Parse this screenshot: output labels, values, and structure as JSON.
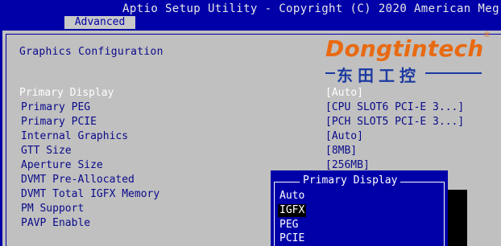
{
  "title_bar": {
    "text": "Aptio Setup Utility - Copyright (C) 2020 American Meg"
  },
  "tabs": [
    {
      "label": "Advanced",
      "active": true
    }
  ],
  "section_title": "Graphics Configuration",
  "settings": [
    {
      "label": "Primary Display",
      "value": "[Auto]",
      "selected": true
    },
    {
      "label": " Primary PEG",
      "value": "[CPU SLOT6 PCI-E 3...]",
      "selected": false
    },
    {
      "label": " Primary PCIE",
      "value": "[PCH SLOT5 PCI-E 3...]",
      "selected": false
    },
    {
      "label": "Internal Graphics",
      "value": "[Auto]",
      "selected": false
    },
    {
      "label": "GTT Size",
      "value": "[8MB]",
      "selected": false
    },
    {
      "label": "Aperture Size",
      "value": "[256MB]",
      "selected": false
    },
    {
      "label": "DVMT Pre-Allocated",
      "value": "",
      "selected": false
    },
    {
      "label": "DVMT Total IGFX Memory",
      "value": "",
      "selected": false
    },
    {
      "label": "PM Support",
      "value": "",
      "selected": false
    },
    {
      "label": "PAVP Enable",
      "value": "",
      "selected": false
    }
  ],
  "popup": {
    "title": "Primary Display",
    "options": [
      "Auto",
      "IGFX",
      "PEG",
      "PCIE"
    ],
    "highlighted_index": 1
  },
  "watermark": {
    "brand": "Dongtintech",
    "registered_mark": "®",
    "chinese_name": "东田工控"
  },
  "colors": {
    "bios_blue": "#0000a8",
    "panel_gray": "#c0c0c0",
    "text_blue": "#0a0a8a",
    "selected_text": "#ffffff",
    "logo_orange": "#e86a12",
    "logo_blue": "#1c3aa0"
  }
}
